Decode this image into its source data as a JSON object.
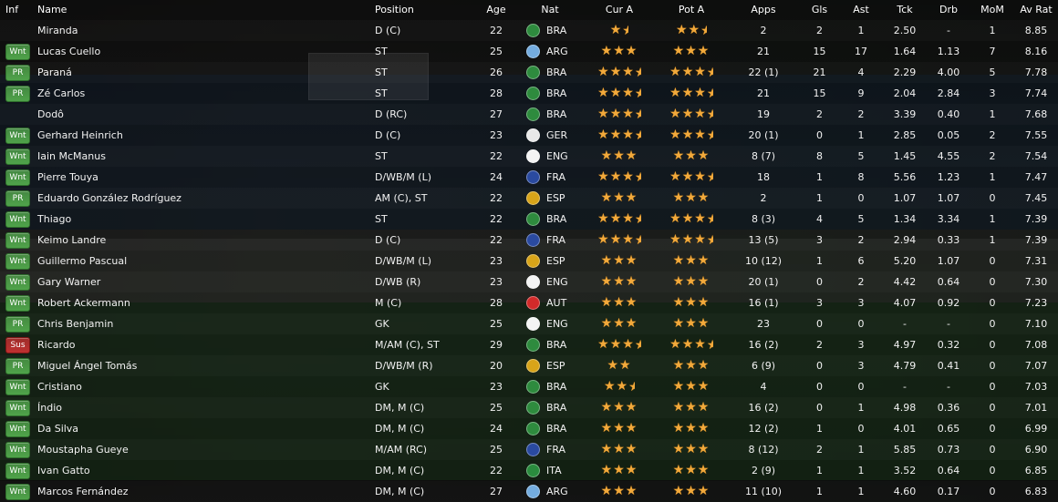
{
  "columns": {
    "inf": "Inf",
    "name": "Name",
    "position": "Position",
    "age": "Age",
    "nat": "Nat",
    "cur_a": "Cur A",
    "pot_a": "Pot A",
    "apps": "Apps",
    "gls": "Gls",
    "ast": "Ast",
    "tck": "Tck",
    "drb": "Drb",
    "mom": "MoM",
    "av_rat": "Av Rat"
  },
  "info_colors": {
    "Wnt": "#4fa34a",
    "PR": "#4fa34a",
    "Sus": "#c03030"
  },
  "flag_colors": {
    "BRA": "#2e8b3e",
    "ARG": "#74acdf",
    "GER": "#e8e8e8",
    "ENG": "#f4f4f4",
    "FRA": "#2a4aa0",
    "ESP": "#d8a419",
    "AUT": "#d22a2a",
    "ITA": "#2a8c3e"
  },
  "players": [
    {
      "inf": "",
      "name": "Miranda",
      "position": "D (C)",
      "age": "22",
      "nat": "BRA",
      "cur_a": 1.5,
      "pot_a": 2.5,
      "apps": "2",
      "gls": "2",
      "ast": "1",
      "tck": "2.50",
      "drb": "-",
      "mom": "1",
      "av_rat": "8.85"
    },
    {
      "inf": "Wnt",
      "name": "Lucas Cuello",
      "position": "ST",
      "age": "25",
      "nat": "ARG",
      "cur_a": 3,
      "pot_a": 3,
      "apps": "21",
      "gls": "15",
      "ast": "17",
      "tck": "1.64",
      "drb": "1.13",
      "mom": "7",
      "av_rat": "8.16"
    },
    {
      "inf": "PR",
      "name": "Paraná",
      "position": "ST",
      "age": "26",
      "nat": "BRA",
      "cur_a": 3.5,
      "pot_a": 3.5,
      "apps": "22 (1)",
      "gls": "21",
      "ast": "4",
      "tck": "2.29",
      "drb": "4.00",
      "mom": "5",
      "av_rat": "7.78"
    },
    {
      "inf": "PR",
      "name": "Zé Carlos",
      "position": "ST",
      "age": "28",
      "nat": "BRA",
      "cur_a": 3.5,
      "pot_a": 3.5,
      "apps": "21",
      "gls": "15",
      "ast": "9",
      "tck": "2.04",
      "drb": "2.84",
      "mom": "3",
      "av_rat": "7.74"
    },
    {
      "inf": "",
      "name": "Dodô",
      "position": "D (RC)",
      "age": "27",
      "nat": "BRA",
      "cur_a": 3.5,
      "pot_a": 3.5,
      "apps": "19",
      "gls": "2",
      "ast": "2",
      "tck": "3.39",
      "drb": "0.40",
      "mom": "1",
      "av_rat": "7.68"
    },
    {
      "inf": "Wnt",
      "name": "Gerhard Heinrich",
      "position": "D (C)",
      "age": "23",
      "nat": "GER",
      "cur_a": 3.5,
      "pot_a": 3.5,
      "apps": "20 (1)",
      "gls": "0",
      "ast": "1",
      "tck": "2.85",
      "drb": "0.05",
      "mom": "2",
      "av_rat": "7.55"
    },
    {
      "inf": "Wnt",
      "name": "Iain McManus",
      "position": "ST",
      "age": "22",
      "nat": "ENG",
      "cur_a": 3,
      "pot_a": 3,
      "apps": "8 (7)",
      "gls": "8",
      "ast": "5",
      "tck": "1.45",
      "drb": "4.55",
      "mom": "2",
      "av_rat": "7.54"
    },
    {
      "inf": "Wnt",
      "name": "Pierre Touya",
      "position": "D/WB/M (L)",
      "age": "24",
      "nat": "FRA",
      "cur_a": 3.5,
      "pot_a": 3.5,
      "apps": "18",
      "gls": "1",
      "ast": "8",
      "tck": "5.56",
      "drb": "1.23",
      "mom": "1",
      "av_rat": "7.47"
    },
    {
      "inf": "PR",
      "name": "Eduardo González Rodríguez",
      "position": "AM (C), ST",
      "age": "22",
      "nat": "ESP",
      "cur_a": 3,
      "pot_a": 3,
      "apps": "2",
      "gls": "1",
      "ast": "0",
      "tck": "1.07",
      "drb": "1.07",
      "mom": "0",
      "av_rat": "7.45"
    },
    {
      "inf": "Wnt",
      "name": "Thiago",
      "position": "ST",
      "age": "22",
      "nat": "BRA",
      "cur_a": 3.5,
      "pot_a": 3.5,
      "apps": "8 (3)",
      "gls": "4",
      "ast": "5",
      "tck": "1.34",
      "drb": "3.34",
      "mom": "1",
      "av_rat": "7.39"
    },
    {
      "inf": "Wnt",
      "name": "Keimo Landre",
      "position": "D (C)",
      "age": "22",
      "nat": "FRA",
      "cur_a": 3.5,
      "pot_a": 3.5,
      "apps": "13 (5)",
      "gls": "3",
      "ast": "2",
      "tck": "2.94",
      "drb": "0.33",
      "mom": "1",
      "av_rat": "7.39"
    },
    {
      "inf": "Wnt",
      "name": "Guillermo Pascual",
      "position": "D/WB/M (L)",
      "age": "23",
      "nat": "ESP",
      "cur_a": 3,
      "pot_a": 3,
      "apps": "10 (12)",
      "gls": "1",
      "ast": "6",
      "tck": "5.20",
      "drb": "1.07",
      "mom": "0",
      "av_rat": "7.31"
    },
    {
      "inf": "Wnt",
      "name": "Gary Warner",
      "position": "D/WB (R)",
      "age": "23",
      "nat": "ENG",
      "cur_a": 3,
      "pot_a": 3,
      "apps": "20 (1)",
      "gls": "0",
      "ast": "2",
      "tck": "4.42",
      "drb": "0.64",
      "mom": "0",
      "av_rat": "7.30"
    },
    {
      "inf": "Wnt",
      "name": "Robert Ackermann",
      "position": "M (C)",
      "age": "28",
      "nat": "AUT",
      "cur_a": 3,
      "pot_a": 3,
      "apps": "16 (1)",
      "gls": "3",
      "ast": "3",
      "tck": "4.07",
      "drb": "0.92",
      "mom": "0",
      "av_rat": "7.23"
    },
    {
      "inf": "PR",
      "name": "Chris Benjamin",
      "position": "GK",
      "age": "25",
      "nat": "ENG",
      "cur_a": 3,
      "pot_a": 3,
      "apps": "23",
      "gls": "0",
      "ast": "0",
      "tck": "-",
      "drb": "-",
      "mom": "0",
      "av_rat": "7.10"
    },
    {
      "inf": "Sus",
      "name": "Ricardo",
      "position": "M/AM (C), ST",
      "age": "29",
      "nat": "BRA",
      "cur_a": 3.5,
      "pot_a": 3.5,
      "apps": "16 (2)",
      "gls": "2",
      "ast": "3",
      "tck": "4.97",
      "drb": "0.32",
      "mom": "0",
      "av_rat": "7.08"
    },
    {
      "inf": "PR",
      "name": "Miguel Ángel Tomás",
      "position": "D/WB/M (R)",
      "age": "20",
      "nat": "ESP",
      "cur_a": 2,
      "pot_a": 3,
      "apps": "6 (9)",
      "gls": "0",
      "ast": "3",
      "tck": "4.79",
      "drb": "0.41",
      "mom": "0",
      "av_rat": "7.07"
    },
    {
      "inf": "Wnt",
      "name": "Cristiano",
      "position": "GK",
      "age": "23",
      "nat": "BRA",
      "cur_a": 2.5,
      "pot_a": 3,
      "apps": "4",
      "gls": "0",
      "ast": "0",
      "tck": "-",
      "drb": "-",
      "mom": "0",
      "av_rat": "7.03"
    },
    {
      "inf": "Wnt",
      "name": "Índio",
      "position": "DM, M (C)",
      "age": "25",
      "nat": "BRA",
      "cur_a": 3,
      "pot_a": 3,
      "apps": "16 (2)",
      "gls": "0",
      "ast": "1",
      "tck": "4.98",
      "drb": "0.36",
      "mom": "0",
      "av_rat": "7.01"
    },
    {
      "inf": "Wnt",
      "name": "Da Silva",
      "position": "DM, M (C)",
      "age": "24",
      "nat": "BRA",
      "cur_a": 3,
      "pot_a": 3,
      "apps": "12 (2)",
      "gls": "1",
      "ast": "0",
      "tck": "4.01",
      "drb": "0.65",
      "mom": "0",
      "av_rat": "6.99"
    },
    {
      "inf": "Wnt",
      "name": "Moustapha Gueye",
      "position": "M/AM (RC)",
      "age": "25",
      "nat": "FRA",
      "cur_a": 3,
      "pot_a": 3,
      "apps": "8 (12)",
      "gls": "2",
      "ast": "1",
      "tck": "5.85",
      "drb": "0.73",
      "mom": "0",
      "av_rat": "6.90"
    },
    {
      "inf": "Wnt",
      "name": "Ivan Gatto",
      "position": "DM, M (C)",
      "age": "22",
      "nat": "ITA",
      "cur_a": 3,
      "pot_a": 3,
      "apps": "2 (9)",
      "gls": "1",
      "ast": "1",
      "tck": "3.52",
      "drb": "0.64",
      "mom": "0",
      "av_rat": "6.85"
    },
    {
      "inf": "Wnt",
      "name": "Marcos Fernández",
      "position": "DM, M (C)",
      "age": "27",
      "nat": "ARG",
      "cur_a": 3,
      "pot_a": 3,
      "apps": "11 (10)",
      "gls": "1",
      "ast": "1",
      "tck": "4.60",
      "drb": "0.17",
      "mom": "0",
      "av_rat": "6.83"
    }
  ]
}
